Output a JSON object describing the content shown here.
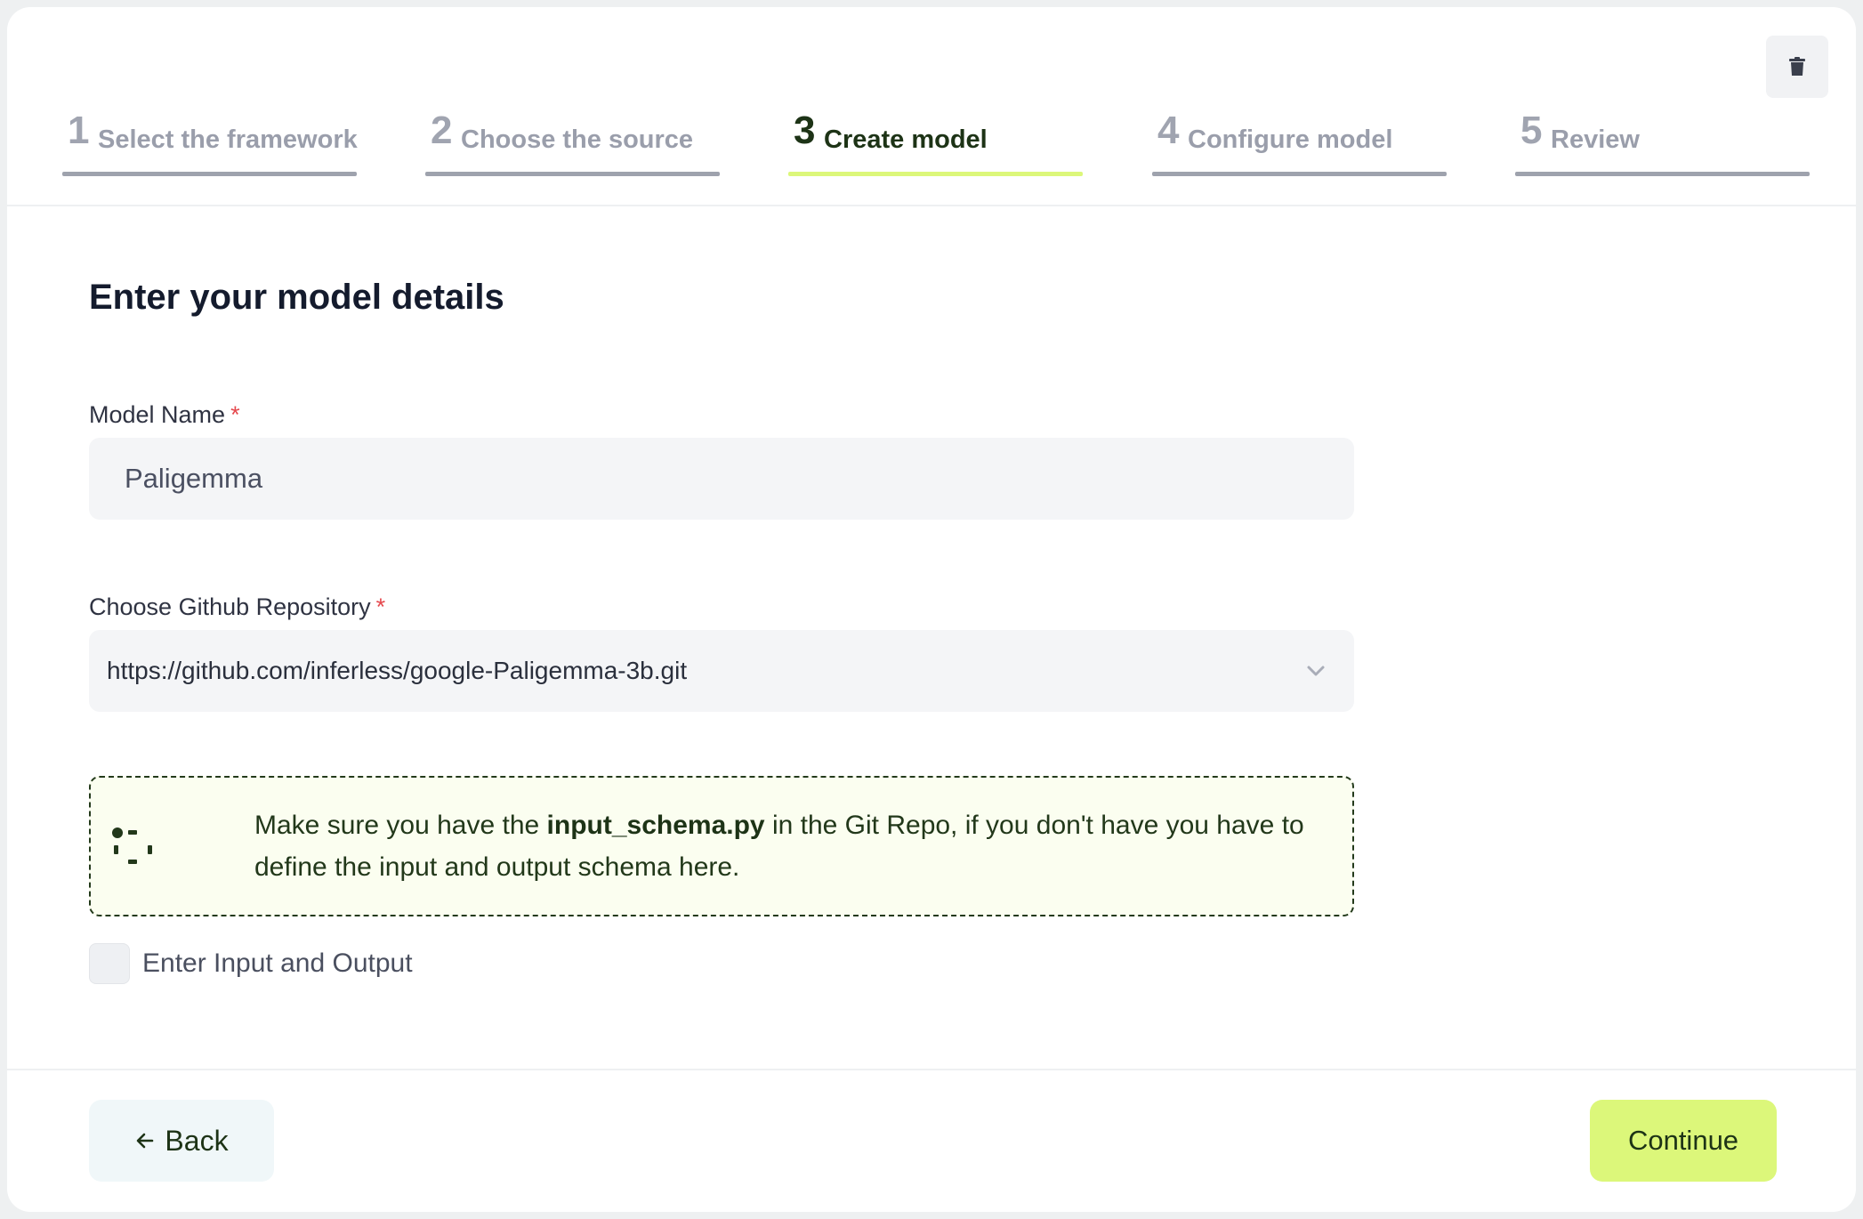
{
  "stepper": {
    "steps": [
      {
        "number": "1",
        "label": "Select the framework",
        "state": "inactive"
      },
      {
        "number": "2",
        "label": "Choose the source",
        "state": "inactive"
      },
      {
        "number": "3",
        "label": "Create model",
        "state": "active"
      },
      {
        "number": "4",
        "label": "Configure model",
        "state": "inactive"
      },
      {
        "number": "5",
        "label": "Review",
        "state": "inactive"
      }
    ]
  },
  "toolbar": {
    "delete_icon": "trash-icon"
  },
  "form": {
    "heading": "Enter your model details",
    "model_name": {
      "label": "Model Name",
      "required_mark": "*",
      "value": "Paligemma"
    },
    "repository": {
      "label": "Choose Github Repository",
      "required_mark": "*",
      "value": "https://github.com/inferless/google-Paligemma-3b.git",
      "icon": "chevron-down-icon"
    },
    "notice": {
      "icon": "info-dots-icon",
      "text_before": "Make sure you have the ",
      "text_bold": "input_schema.py",
      "text_after": " in the Git Repo, if you don't have you have to define the input and output schema here."
    },
    "io_checkbox": {
      "label": "Enter Input and Output",
      "checked": false
    }
  },
  "footer": {
    "back_label": "Back",
    "back_icon": "arrow-left-icon",
    "continue_label": "Continue"
  },
  "colors": {
    "accent": "#dcf77a",
    "active_text": "#1d3316",
    "inactive_step": "#9ea2ad",
    "required": "#e5484d",
    "notice_bg": "#fbfef0"
  }
}
